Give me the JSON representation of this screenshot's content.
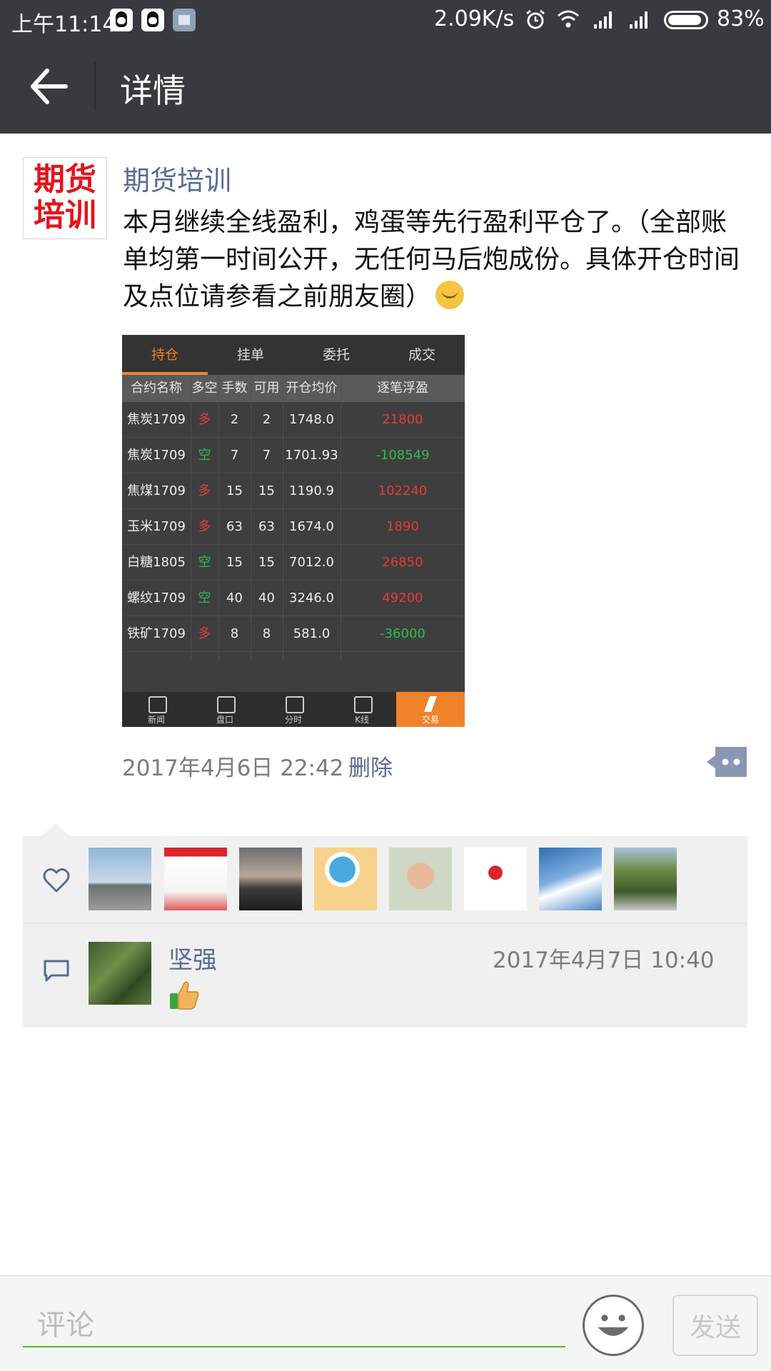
{
  "status_bar": {
    "time": "上午11:14",
    "speed": "2.09K/s",
    "battery": "83%"
  },
  "header": {
    "title": "详情",
    "back_icon": "arrow-left-icon"
  },
  "post": {
    "avatar_text_line1": "期货",
    "avatar_text_line2": "培训",
    "author": "期货培训",
    "text": "本月继续全线盈利，鸡蛋等先行盈利平仓了。（全部账单均第一时间公开，无任何马后炮成份。具体开仓时间及点位请参看之前朋友圈）",
    "timestamp": "2017年4月6日 22:42",
    "delete_label": "删除",
    "image": {
      "tabs": [
        "持仓",
        "挂单",
        "委托",
        "成交"
      ],
      "active_tab": 0,
      "columns": [
        "合约名称",
        "多空",
        "手数",
        "可用",
        "开仓均价",
        "逐笔浮盈"
      ],
      "rows": [
        {
          "name": "焦炭1709",
          "dir": "多",
          "lots": "2",
          "avail": "2",
          "price": "1748.0",
          "pnl": "21800"
        },
        {
          "name": "焦炭1709",
          "dir": "空",
          "lots": "7",
          "avail": "7",
          "price": "1701.93",
          "pnl": "-108549"
        },
        {
          "name": "焦煤1709",
          "dir": "多",
          "lots": "15",
          "avail": "15",
          "price": "1190.9",
          "pnl": "102240"
        },
        {
          "name": "玉米1709",
          "dir": "多",
          "lots": "63",
          "avail": "63",
          "price": "1674.0",
          "pnl": "1890"
        },
        {
          "name": "白糖1805",
          "dir": "空",
          "lots": "15",
          "avail": "15",
          "price": "7012.0",
          "pnl": "26850"
        },
        {
          "name": "螺纹1709",
          "dir": "空",
          "lots": "40",
          "avail": "40",
          "price": "3246.0",
          "pnl": "49200"
        },
        {
          "name": "铁矿1709",
          "dir": "多",
          "lots": "8",
          "avail": "8",
          "price": "581.0",
          "pnl": "-36000"
        }
      ],
      "bottom_nav": [
        "新闻",
        "盘口",
        "分时",
        "K线",
        "交易"
      ],
      "colors": {
        "long": "#e53b3b",
        "short": "#2ebd4f",
        "accent": "#f0822a"
      }
    }
  },
  "likes": {
    "icon": "heart-icon",
    "avatar_count": 8
  },
  "comments": [
    {
      "name": "坚强",
      "time": "2017年4月7日 10:40",
      "content_icon": "thumbs-up-icon"
    }
  ],
  "input_bar": {
    "placeholder": "评论",
    "send_label": "发送",
    "emoji_icon": "smiley-face-icon"
  },
  "colors": {
    "header_bg": "#393a3f",
    "link_blue": "#576b95",
    "input_underline": "#45c01a"
  }
}
